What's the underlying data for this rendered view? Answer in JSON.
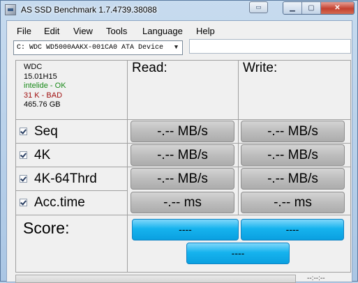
{
  "window": {
    "title": "AS SSD Benchmark 1.7.4739.38088",
    "icons": [
      "app-icon",
      "restore-extra-icon",
      "minimize-icon",
      "maximize-icon",
      "close-icon"
    ]
  },
  "menu": {
    "items": [
      "File",
      "Edit",
      "View",
      "Tools",
      "Language",
      "Help"
    ]
  },
  "device": {
    "selected": "C: WDC WD5000AAKX-001CA0 ATA Device",
    "path_value": ""
  },
  "drive_info": {
    "model": "WDC",
    "firmware": "15.01H15",
    "driver": "intelide - OK",
    "alignment": "31 K - BAD",
    "size": "465.76 GB",
    "colors": {
      "ok": "#1a8a1a",
      "bad": "#a01010"
    }
  },
  "headers": {
    "read": "Read:",
    "write": "Write:"
  },
  "tests": [
    {
      "label": "Seq",
      "checked": true,
      "read": "-.-- MB/s",
      "write": "-.-- MB/s"
    },
    {
      "label": "4K",
      "checked": true,
      "read": "-.-- MB/s",
      "write": "-.-- MB/s"
    },
    {
      "label": "4K-64Thrd",
      "checked": true,
      "read": "-.-- MB/s",
      "write": "-.-- MB/s"
    },
    {
      "label": "Acc.time",
      "checked": true,
      "read": "-.-- ms",
      "write": "-.-- ms"
    }
  ],
  "score": {
    "label": "Score:",
    "read": "----",
    "write": "----",
    "total": "----",
    "color": "#16b3ee"
  },
  "status": {
    "time": "--:--:--"
  }
}
